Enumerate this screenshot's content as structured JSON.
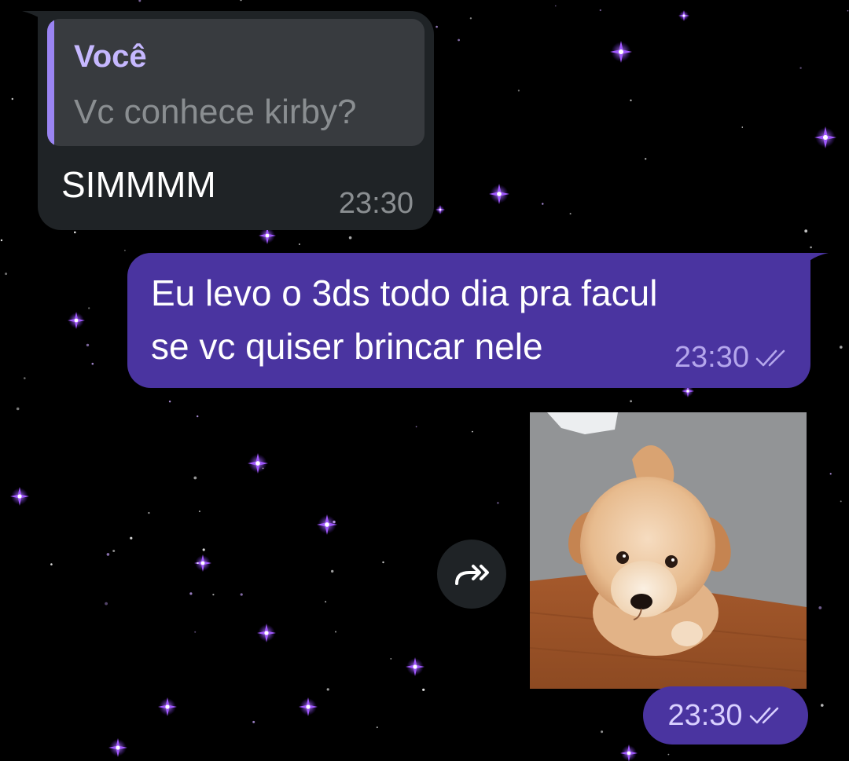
{
  "theme": {
    "background": "#000000",
    "incoming_bubble": "#1f2326",
    "outgoing_bubble": "#4a34a0",
    "reply_accent": "#9a84f2",
    "star_color": "#a259ff"
  },
  "messages": {
    "incoming": {
      "reply": {
        "author": "Você",
        "text": "Vc conhece kirby?"
      },
      "text": "SIMMMM",
      "time": "23:30"
    },
    "outgoing_text": {
      "line1": "Eu levo o 3ds todo dia pra facul",
      "line2": "se vc quiser brincar nele",
      "time": "23:30",
      "status_icon": "double-check-icon"
    },
    "outgoing_media": {
      "type": "gif",
      "subject": "puppy",
      "time": "23:30",
      "status_icon": "double-check-icon",
      "forward_icon": "forward-icon"
    }
  }
}
